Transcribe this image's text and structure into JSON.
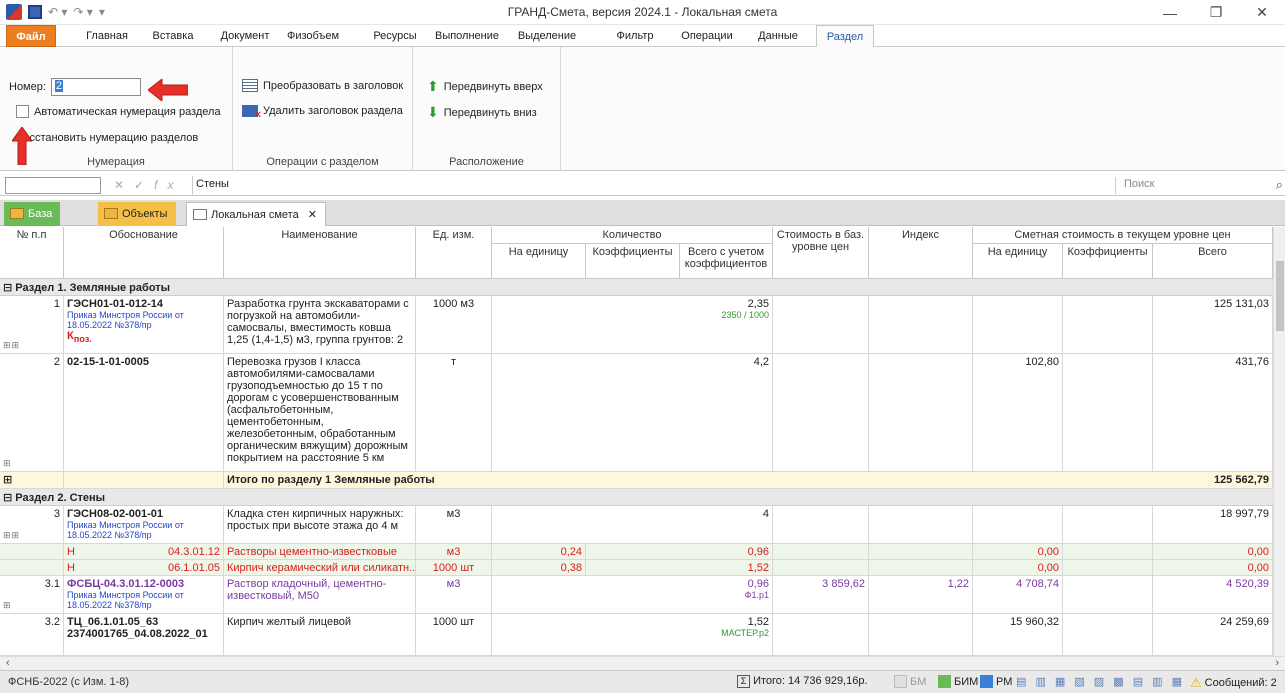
{
  "window": {
    "title": "ГРАНД-Смета, версия 2024.1 - Локальная смета"
  },
  "ribbon_tabs": [
    "Файл",
    "Главная",
    "Вставка",
    "Документ",
    "Физобъем",
    "Ресурсы",
    "Выполнение",
    "Выделение",
    "Фильтр",
    "Операции",
    "Данные",
    "Раздел"
  ],
  "numbering": {
    "number_label": "Номер:",
    "number_value": "2",
    "auto_label": "Автоматическая нумерация раздела",
    "restore_label": "Восстановить нумерацию разделов",
    "caption": "Нумерация"
  },
  "section_ops": {
    "convert": "Преобразовать в заголовок",
    "delete": "Удалить заголовок раздела",
    "caption": "Операции с разделом"
  },
  "location": {
    "up": "Передвинуть вверх",
    "down": "Передвинуть вниз",
    "caption": "Расположение"
  },
  "formula_bar": {
    "value": "Стены",
    "search_placeholder": "Поиск"
  },
  "doc_tabs": {
    "baza": "База",
    "objects": "Объекты",
    "local": "Локальная смета"
  },
  "headers": {
    "num": "№ п.п",
    "basis": "Обоснование",
    "name": "Наименование",
    "unit": "Ед. изм.",
    "qty": "Количество",
    "qty_per": "На единицу",
    "qty_coef": "Коэффициенты",
    "qty_total": "Всего с учетом коэффициентов",
    "base_cost": "Стоимость в баз. уровне цен",
    "index": "Индекс",
    "cur": "Сметная стоимость в текущем уровне цен",
    "cur_per": "На единицу",
    "cur_coef": "Коэффициенты",
    "cur_total": "Всего"
  },
  "rows": {
    "sec1": "Раздел 1. Земляные работы",
    "r1": {
      "num": "1",
      "code": "ГЭСН01-01-012-14",
      "order": "Приказ Минстроя России от 18.05.2022 №378/пр",
      "kpos": "К",
      "kpos_sub": "поз.",
      "name": "Разработка грунта экскаваторами с погрузкой на автомобили-самосвалы, вместимость ковша 1,25 (1,4-1,5) м3, группа грунтов: 2",
      "unit": "1000 м3",
      "qty_total": "2,35",
      "qty_formula": "2350 / 1000",
      "cur_total": "125 131,03"
    },
    "r2": {
      "num": "2",
      "code": "02-15-1-01-0005",
      "name": "Перевозка грузов I класса автомобилями-самосвалами грузоподъемностью до 15 т по дорогам с усовершенствованным (асфальтобетонным, цементобетонным, железобетонным, обработанным органическим вяжущим) дорожным покрытием на расстояние 5 км",
      "unit": "т",
      "qty_total": "4,2",
      "cur_per": "102,80",
      "cur_total": "431,76"
    },
    "tot1": {
      "label": "Итого по разделу 1 Земляные работы",
      "total": "125 562,79"
    },
    "sec2": "Раздел 2. Стены",
    "r3": {
      "num": "3",
      "code": "ГЭСН08-02-001-01",
      "order": "Приказ Минстроя России от 18.05.2022 №378/пр",
      "name": "Кладка стен кирпичных наружных: простых при высоте этажа до 4 м",
      "unit": "м3",
      "qty_total": "4",
      "cur_total": "18 997,79"
    },
    "h1": {
      "mark": "Н",
      "code": "04.3.01.12",
      "name": "Растворы цементно-известковые",
      "unit": "м3",
      "qty_per": "0,24",
      "qty_total": "0,96",
      "cur_per": "0,00",
      "cur_total": "0,00"
    },
    "h2": {
      "mark": "Н",
      "code": "06.1.01.05",
      "name": "Кирпич керамический или силикатн...",
      "unit": "1000 шт",
      "qty_per": "0,38",
      "qty_total": "1,52",
      "cur_per": "0,00",
      "cur_total": "0,00"
    },
    "r31": {
      "num": "3.1",
      "code": "ФСБЦ-04.3.01.12-0003",
      "order": "Приказ Минстроя России от 18.05.2022 №378/пр",
      "name": "Раствор кладочный, цементно-известковый, М50",
      "unit": "м3",
      "qty_total": "0,96",
      "qty_formula": "Ф1.р1",
      "base": "3 859,62",
      "index": "1,22",
      "cur_per": "4 708,74",
      "cur_total": "4 520,39"
    },
    "r32": {
      "num": "3.2",
      "code": "ТЦ_06.1.01.05_63 2374001765_04.08.2022_01",
      "name": "Кирпич желтый лицевой",
      "unit": "1000 шт",
      "qty_total": "1,52",
      "qty_formula": "МАСТЕР.р2",
      "cur_per": "15 960,32",
      "cur_total": "24 259,69"
    }
  },
  "status": {
    "left": "ФСНБ-2022 (с Изм. 1-8)",
    "total": "Итого: 14 736 929,16р.",
    "bm": "БМ",
    "bim": "БИМ",
    "rm": "РМ",
    "messages": "Сообщений: 2"
  }
}
